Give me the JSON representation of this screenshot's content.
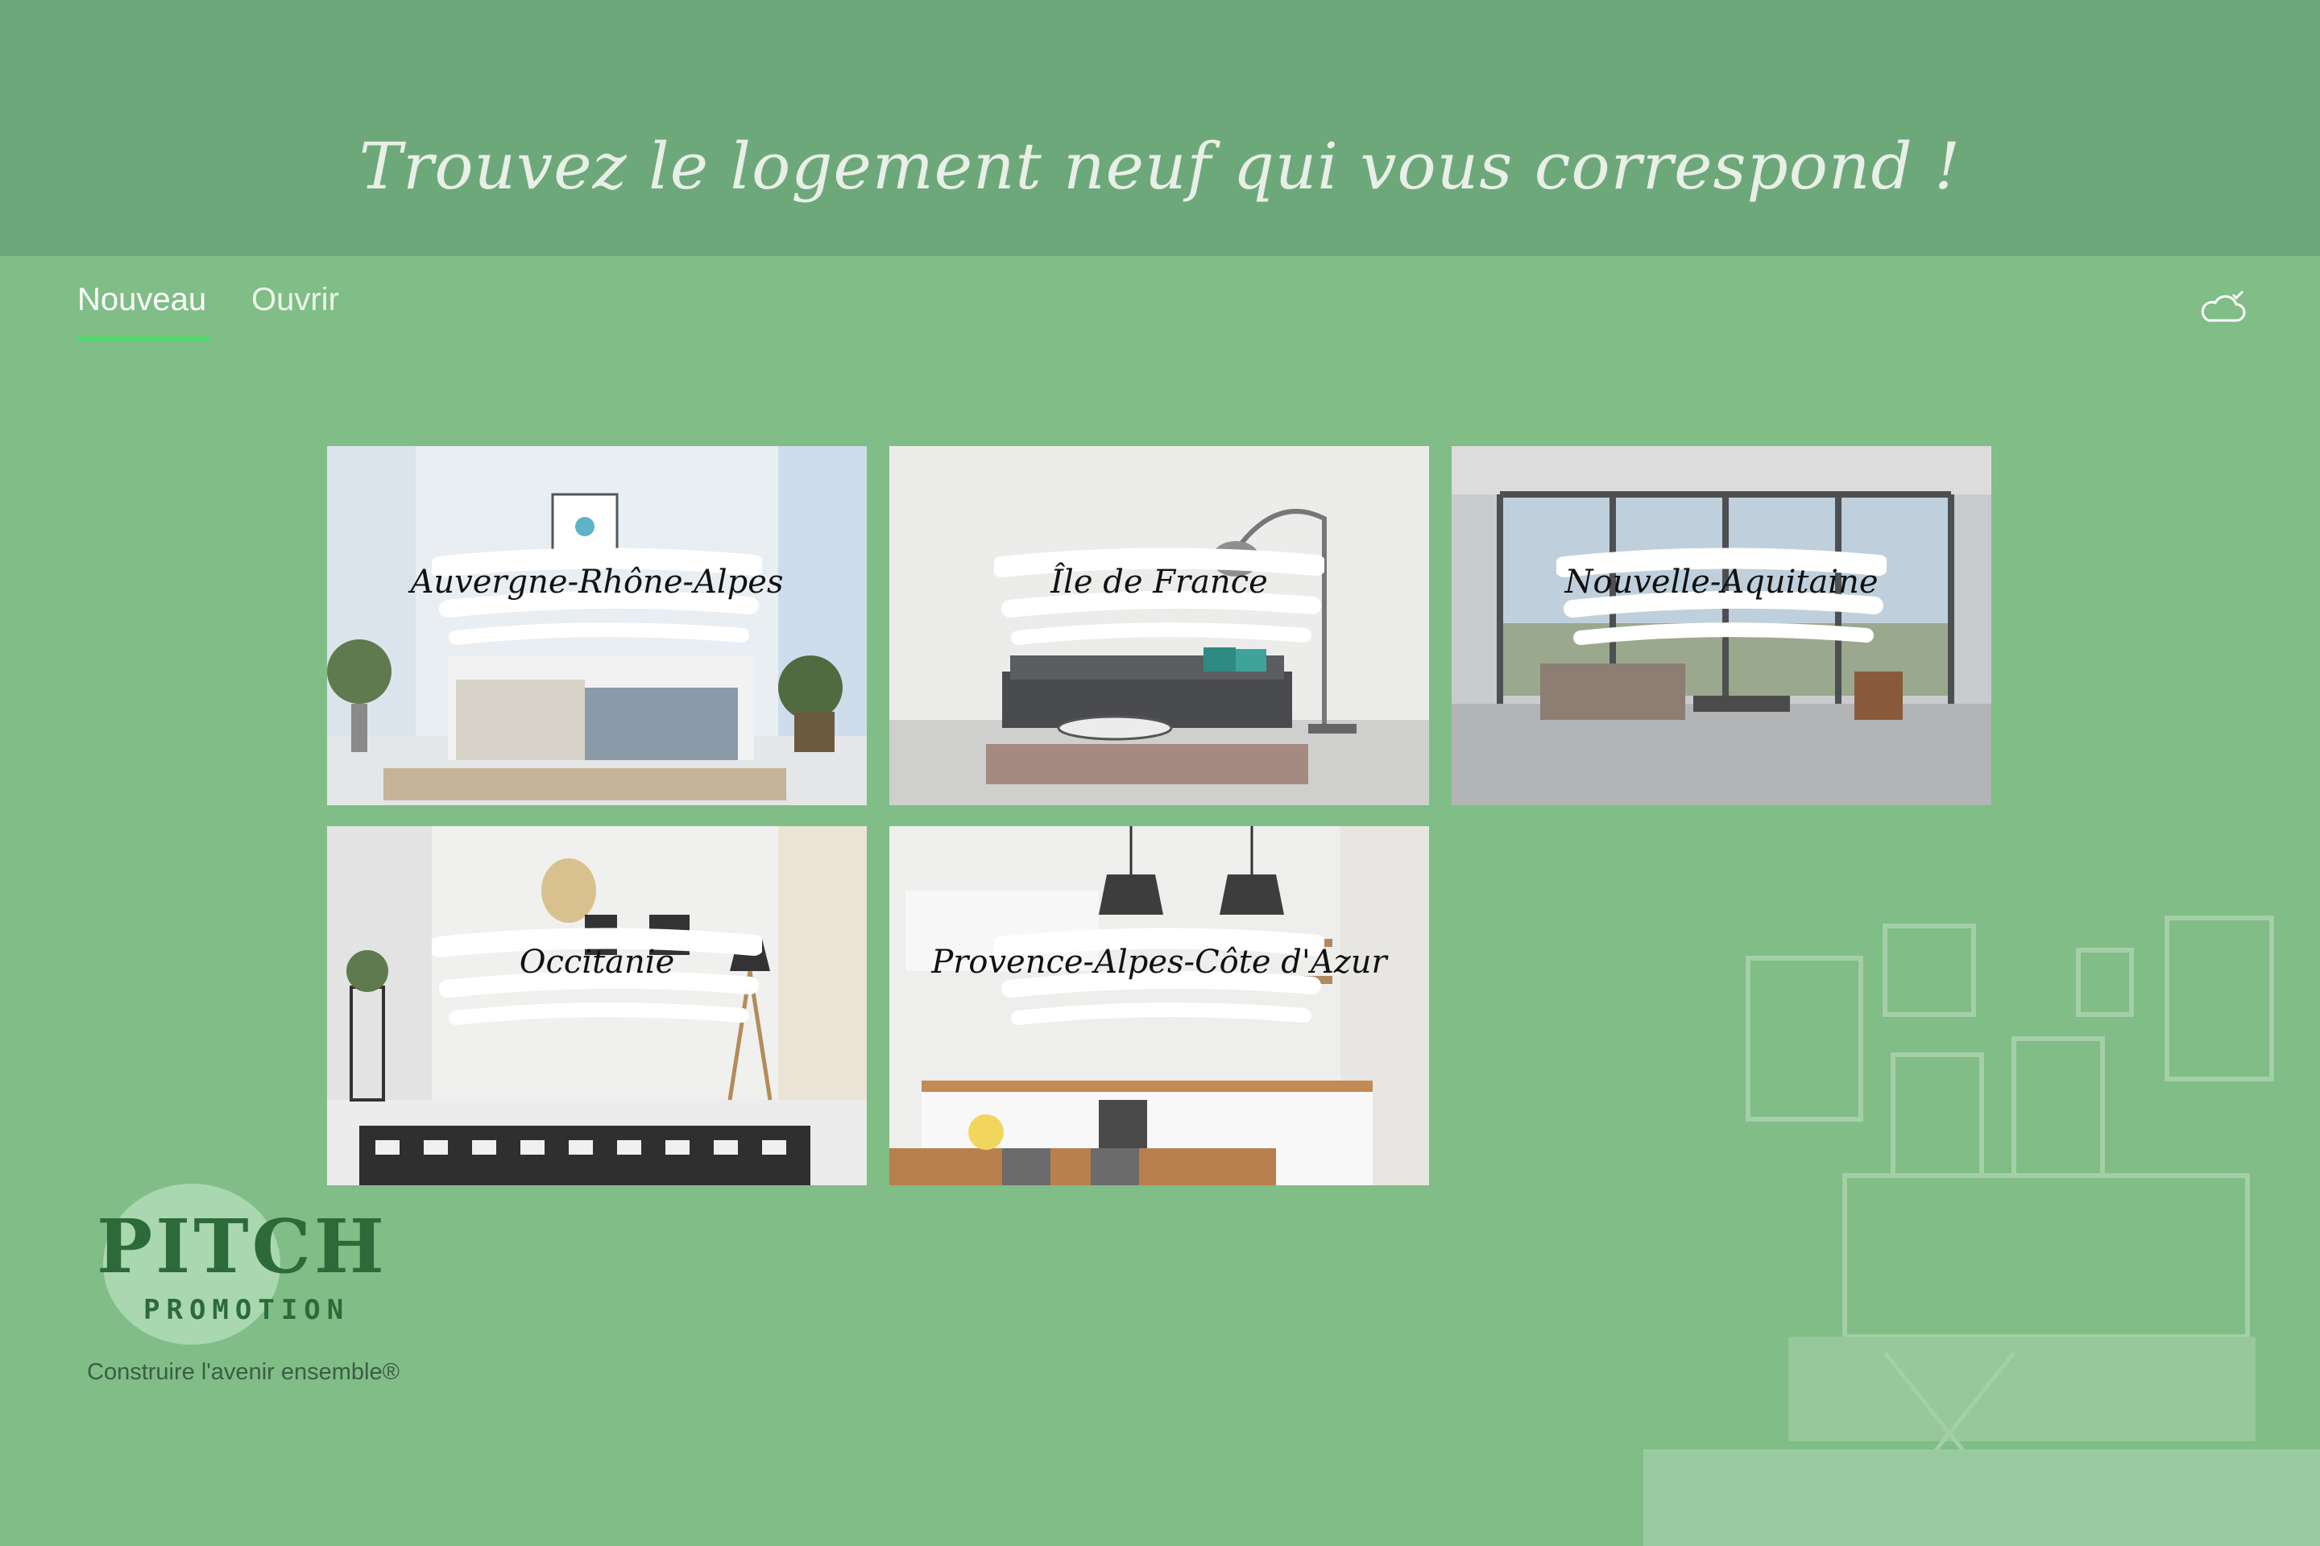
{
  "header": {
    "title": "Trouvez le logement neuf qui vous correspond !"
  },
  "tabs": [
    {
      "label": "Nouveau",
      "active": true
    },
    {
      "label": "Ouvrir",
      "active": false
    }
  ],
  "sync_icon": "cloud-check-icon",
  "regions": [
    {
      "label": "Auvergne-Rhône-Alpes"
    },
    {
      "label": "Île de France"
    },
    {
      "label": "Nouvelle-Aquitaine"
    },
    {
      "label": "Occitanie"
    },
    {
      "label": "Provence-Alpes-Côte d'Azur"
    }
  ],
  "brand": {
    "logo_line1": "PITCH",
    "logo_line2": "PROMOTION",
    "tagline": "Construire l'avenir ensemble®"
  },
  "colors": {
    "background": "#80bd87",
    "banner": "#6da87a",
    "tab_underline": "#47e064"
  }
}
